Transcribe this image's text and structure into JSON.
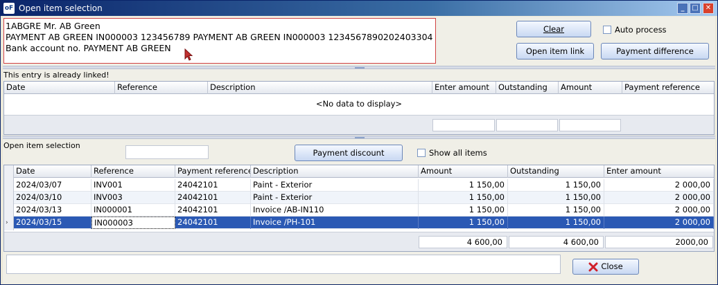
{
  "window": {
    "title": "Open item selection",
    "app_icon": "oF"
  },
  "memo": {
    "lines": [
      "1ABGRE Mr. AB Green",
      "PAYMENT AB GREEN IN000003 123456789 PAYMENT AB GREEN IN000003 1234567890202403304",
      "Bank account no. PAYMENT AB GREEN"
    ]
  },
  "buttons": {
    "clear": "Clear",
    "open_item_link": "Open item link",
    "payment_difference": "Payment difference",
    "payment_discount": "Payment discount",
    "close": "Close"
  },
  "checkboxes": {
    "auto_process": "Auto process",
    "show_all_items": "Show all items"
  },
  "linked": {
    "notice": "This entry is already linked!",
    "columns": [
      "Date",
      "Reference",
      "Description",
      "Enter amount",
      "Outstanding",
      "Amount",
      "Payment reference"
    ],
    "empty_text": "<No data to display>"
  },
  "open_items": {
    "label": "Open item selection",
    "search_value": "",
    "columns": [
      "Date",
      "Reference",
      "Payment reference",
      "Description",
      "Amount",
      "Outstanding",
      "Enter amount"
    ],
    "rows": [
      {
        "date": "2024/03/07",
        "reference": "INV001",
        "payment_reference": "24042101",
        "description": "Paint - Exterior",
        "amount": "1 150,00",
        "outstanding": "1 150,00",
        "enter_amount": "2 000,00"
      },
      {
        "date": "2024/03/10",
        "reference": "INV003",
        "payment_reference": "24042101",
        "description": "Paint - Exterior",
        "amount": "1 150,00",
        "outstanding": "1 150,00",
        "enter_amount": "2 000,00"
      },
      {
        "date": "2024/03/13",
        "reference": "IN000001",
        "payment_reference": "24042101",
        "description": "Invoice /AB-IN110",
        "amount": "1 150,00",
        "outstanding": "1 150,00",
        "enter_amount": "2 000,00"
      },
      {
        "date": "2024/03/15",
        "reference": "IN000003",
        "payment_reference": "24042101",
        "description": "Invoice /PH-101",
        "amount": "1 150,00",
        "outstanding": "1 150,00",
        "enter_amount": "2 000,00"
      }
    ],
    "selected_row": 3,
    "totals": {
      "amount": "4 600,00",
      "outstanding": "4 600,00",
      "enter_amount": "2000,00"
    }
  },
  "colors": {
    "selection": "#2b59b4",
    "memo_border": "#d04040",
    "titlebar": "#0a246a",
    "close_icon": "#d0202a"
  }
}
